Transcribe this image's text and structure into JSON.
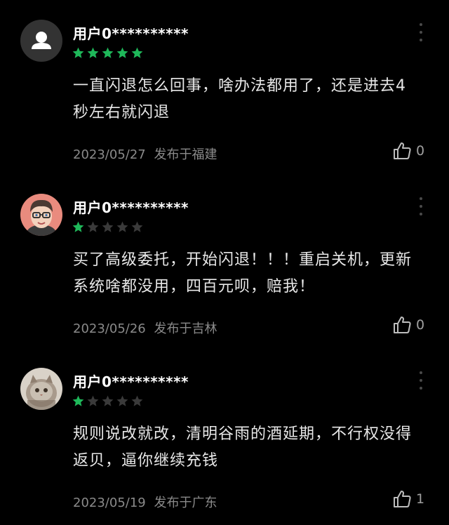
{
  "reviews": [
    {
      "username": "用户0**********",
      "rating": 5,
      "content": "一直闪退怎么回事，啥办法都用了，还是进去4秒左右就闪退",
      "date": "2023/05/27",
      "location": "发布于福建",
      "likes": "0",
      "avatar": "default-person-icon"
    },
    {
      "username": "用户0**********",
      "rating": 1,
      "content": "买了高级委托，开始闪退！！！重启关机，更新系统啥都没用，四百元呗，赔我！",
      "date": "2023/05/26",
      "location": "发布于吉林",
      "likes": "0",
      "avatar": "cartoon-face"
    },
    {
      "username": "用户0**********",
      "rating": 1,
      "content": "规则说改就改，清明谷雨的酒延期，不行权没得返贝，逼你继续充钱",
      "date": "2023/05/19",
      "location": "发布于广东",
      "likes": "1",
      "avatar": "cat-photo"
    }
  ],
  "colors": {
    "star_filled": "#1fb85a",
    "star_empty": "#3a3a3a",
    "background": "#000000"
  }
}
